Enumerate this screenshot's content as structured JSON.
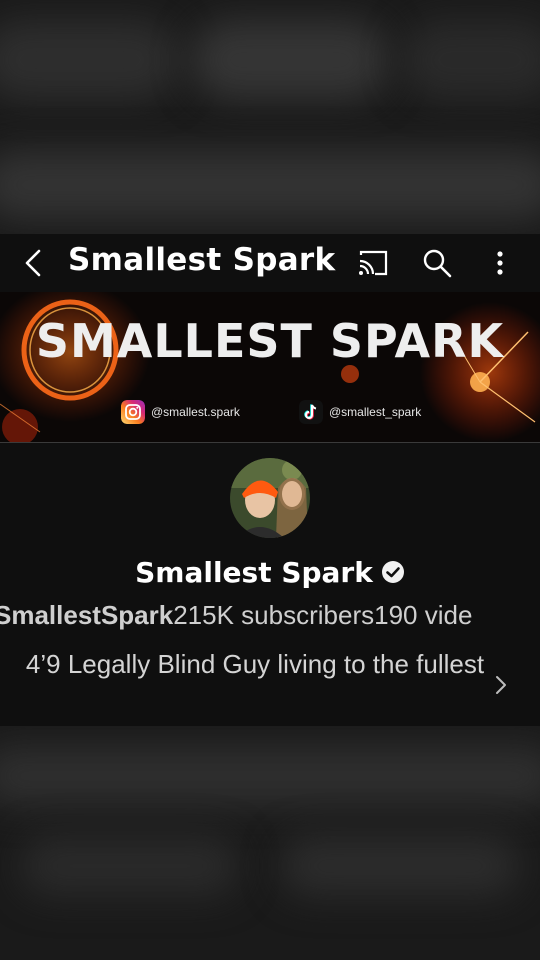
{
  "header": {
    "title": "Smallest Spark",
    "icons": [
      "back-arrow-icon",
      "cast-icon",
      "search-icon",
      "more-vertical-icon"
    ]
  },
  "banner": {
    "title": "SMALLEST SPARK",
    "instagram_handle": "@smallest.spark",
    "tiktok_handle": "@smallest_spark"
  },
  "channel": {
    "name": "Smallest Spark",
    "handle": "SmallestSpark",
    "subscribers": "215K subscribers",
    "videos": "190 vide",
    "description": "4’9 Legally Blind Guy living to the fullest",
    "verified": true
  },
  "colors": {
    "background": "#0f0f0f",
    "text": "#ffffff",
    "secondary_text": "#cfcfcf",
    "banner_fire": "#ff6a1a"
  }
}
